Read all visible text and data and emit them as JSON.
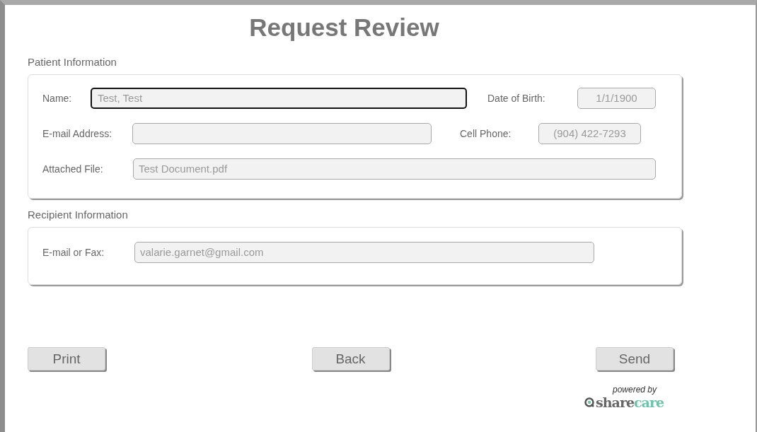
{
  "title": "Request Review",
  "sections": [
    {
      "label": "Patient Information",
      "rows": [
        [
          {
            "label": "Name:",
            "value": "Test, Test",
            "focused": true
          },
          {
            "label": "Date of Birth:",
            "value": "1/1/1900",
            "focused": false
          }
        ],
        [
          {
            "label": "E-mail Address:",
            "focused": false
          },
          {
            "label": "Cell Phone:",
            "value": "(904) 422-7293",
            "focused": false
          }
        ],
        [
          {
            "label": "Attached File:",
            "value": "Test Document.pdf",
            "focused": false
          }
        ]
      ]
    },
    {
      "label": "Recipient Information",
      "rows": [
        [
          {
            "label": "E-mail or Fax:",
            "value": "valarie.garnet@gmail.com",
            "focused": false
          }
        ]
      ]
    }
  ],
  "buttons": [
    "Print",
    "Back",
    "Send"
  ],
  "logo": {
    "tagline": "powered by",
    "name_parts": [
      "share",
      "care"
    ]
  }
}
